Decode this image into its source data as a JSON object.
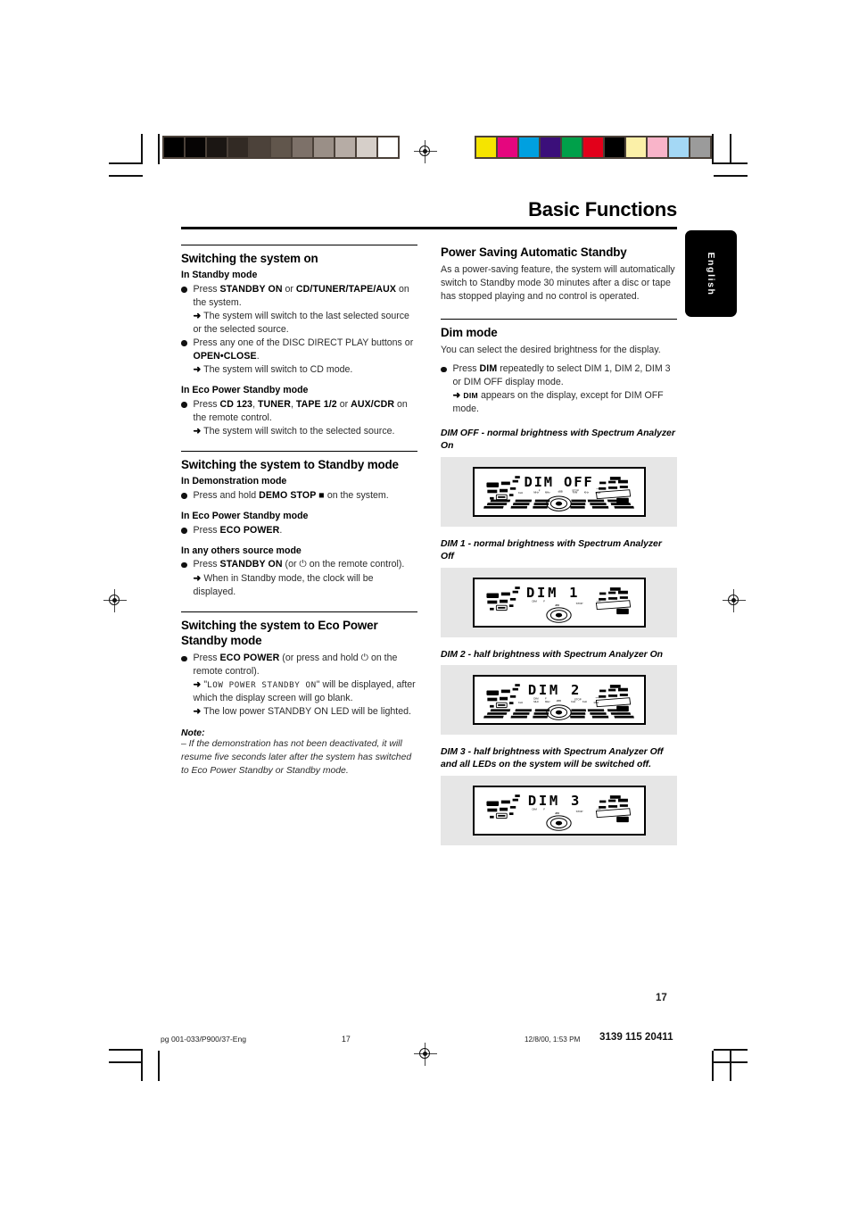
{
  "header": {
    "doc_title": "Basic Functions",
    "language_tab": "English"
  },
  "left_column": {
    "section1": {
      "heading": "Switching the system on",
      "sub1": "In Standby mode",
      "b1_line1_a": "Press ",
      "b1_line1_b": "STANDBY ON",
      "b1_line1_c": " or ",
      "b1_line1_d": "CD/TUNER/",
      "b1_line2_b": "TAPE/AUX",
      "b1_line2_c": " on the system.",
      "b1_arrow": "The system will switch to the last selected source or the selected source.",
      "b2_line_a": "Press any one of the DISC DIRECT PLAY buttons or ",
      "b2_line_b": "OPEN•CLOSE",
      "b2_line_c": ".",
      "b2_arrow": "The system will switch to CD mode.",
      "sub2": "In Eco Power Standby mode",
      "b3_a": "Press ",
      "b3_b": "CD 123",
      "b3_c": ", ",
      "b3_d": "TUNER",
      "b3_e": ", ",
      "b3_f": "TAPE 1/2",
      "b3_g": " or ",
      "b3_h": "AUX/",
      "b3_i": "CDR",
      "b3_j": " on the remote control.",
      "b3_arrow": "The system will switch to the selected source."
    },
    "section2": {
      "heading": "Switching the system to Standby mode",
      "sub1": "In Demonstration mode",
      "b1_a": "Press and hold ",
      "b1_b": "DEMO STOP",
      "b1_c": " ■ ",
      "b1_d": "on the system.",
      "sub2": "In Eco Power Standby mode",
      "b2_a": "Press ",
      "b2_b": "ECO POWER",
      "b2_c": ".",
      "sub3": "In any others source mode",
      "b3_a": "Press ",
      "b3_b": "STANDBY ON",
      "b3_c": " (or ⏻ on the remote control).",
      "b3_arrow": "When in Standby mode, the clock will be displayed."
    },
    "section3": {
      "heading": "Switching the system to Eco Power Standby mode",
      "b1_a": "Press ",
      "b1_b": "ECO POWER",
      "b1_c": " (or press and hold ⏻ on the remote control).",
      "b1_arrow_pre": "\"",
      "b1_arrow_lcd": "LOW POWER STANDBY ON",
      "b1_arrow_post": "\" will be displayed, after which the display screen will go blank.",
      "b2_arrow": "The low power STANDBY ON LED will be lighted.",
      "note_head": "Note:",
      "note_body": "– If the demonstration has not been deactivated, it will resume five seconds later after the system has switched to Eco Power Standby or Standby mode."
    }
  },
  "right_column": {
    "section1": {
      "heading": "Power Saving Automatic Standby",
      "body": "As a power-saving feature, the system will automatically switch to Standby mode 30 minutes after a disc or tape has stopped playing and no control is operated."
    },
    "section2": {
      "heading": "Dim mode",
      "intro": "You can select the desired brightness for the display.",
      "b1_a": "Press ",
      "b1_b": "DIM",
      "b1_c": " repeatedly to select DIM 1, DIM 2, DIM 3 or DIM OFF display mode.",
      "b1_arrow_dim": "DIM",
      "b1_arrow_rest": " appears on the display, except for DIM OFF mode."
    },
    "illustrations": [
      {
        "caption": "DIM OFF - normal brightness with Spectrum Analyzer On",
        "lcd_text": "DIM OFF",
        "spectrum_on": true,
        "dim_indicator": false
      },
      {
        "caption": "DIM 1 - normal brightness with Spectrum Analyzer Off",
        "lcd_text": "DIM 1",
        "spectrum_on": false,
        "dim_indicator": true
      },
      {
        "caption": "DIM 2 - half brightness with Spectrum Analyzer On",
        "lcd_text": "DIM 2",
        "spectrum_on": true,
        "dim_indicator": true
      },
      {
        "caption": "DIM 3 - half brightness with Spectrum Analyzer Off and all LEDs on the system will be switched off.",
        "lcd_text": "DIM 3",
        "spectrum_on": false,
        "dim_indicator": true
      }
    ]
  },
  "footer": {
    "page_number": "17",
    "file_ref": "pg 001-033/P900/37-Eng",
    "footer_page": "17",
    "date": "12/8/00, 1:53 PM",
    "code": "3139 115 20411"
  },
  "colorbars": {
    "grayscale": [
      "#000000",
      "#060404",
      "#1b1613",
      "#322a24",
      "#4c423a",
      "#61564c",
      "#7d7169",
      "#9a8f87",
      "#b6aca5",
      "#d6cfc9",
      "#ffffff"
    ],
    "process": [
      "#f5e400",
      "#e5067e",
      "#00a0e0",
      "#3b0f7a",
      "#00a04a",
      "#e2001a",
      "#000000",
      "#fbf0a8",
      "#f9b4c9",
      "#a4d8f5",
      "#9b9b9b"
    ]
  }
}
